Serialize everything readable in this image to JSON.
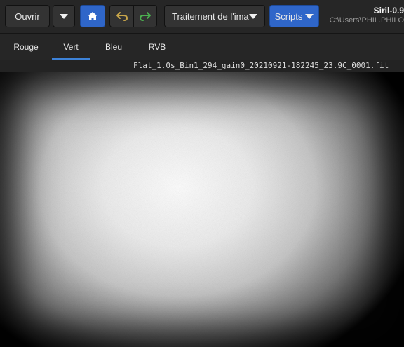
{
  "toolbar": {
    "open_label": "Ouvrir",
    "processing_label": "Traitement de l'ima…",
    "scripts_label": "Scripts",
    "icons": {
      "open_menu": "chevron-down-icon",
      "home": "home-icon",
      "undo": "undo-icon",
      "redo": "redo-icon"
    }
  },
  "window": {
    "title": "Siril-0.9",
    "path": "C:\\Users\\PHIL.PHILO"
  },
  "tabs": [
    {
      "label": "Rouge",
      "active": false
    },
    {
      "label": "Vert",
      "active": true
    },
    {
      "label": "Bleu",
      "active": false
    },
    {
      "label": "RVB",
      "active": false
    }
  ],
  "image": {
    "filename": "Flat_1.0s_Bin1_294_gain0_20210921-182245_23.9C_0001.fit"
  },
  "colors": {
    "accent": "#2f66c9",
    "tab_indicator": "#3d82d8",
    "undo_arrow": "#c9a64a",
    "redo_arrow": "#4caf50"
  }
}
